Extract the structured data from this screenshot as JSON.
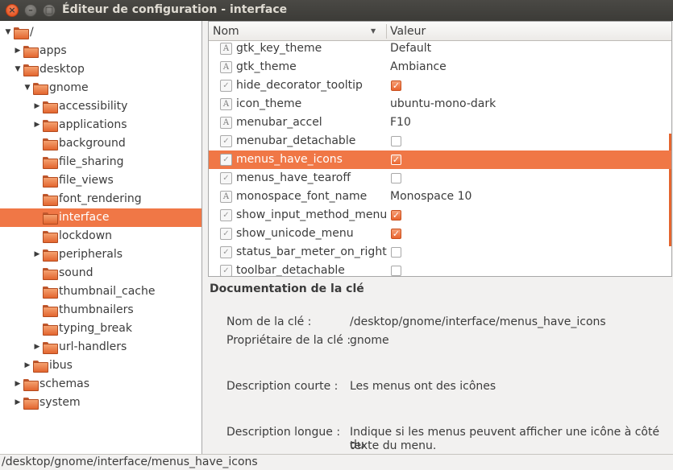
{
  "window": {
    "title": "Éditeur de configuration - interface",
    "close_glyph": "×",
    "min_glyph": "–",
    "max_glyph": "□"
  },
  "tree": {
    "items": [
      {
        "label": "/",
        "level": 0,
        "expanded": true,
        "has_children": true,
        "selected": false
      },
      {
        "label": "apps",
        "level": 1,
        "expanded": false,
        "has_children": true,
        "selected": false
      },
      {
        "label": "desktop",
        "level": 1,
        "expanded": true,
        "has_children": true,
        "selected": false
      },
      {
        "label": "gnome",
        "level": 2,
        "expanded": true,
        "has_children": true,
        "selected": false
      },
      {
        "label": "accessibility",
        "level": 3,
        "expanded": false,
        "has_children": true,
        "selected": false
      },
      {
        "label": "applications",
        "level": 3,
        "expanded": false,
        "has_children": true,
        "selected": false
      },
      {
        "label": "background",
        "level": 3,
        "expanded": false,
        "has_children": false,
        "selected": false
      },
      {
        "label": "file_sharing",
        "level": 3,
        "expanded": false,
        "has_children": false,
        "selected": false
      },
      {
        "label": "file_views",
        "level": 3,
        "expanded": false,
        "has_children": false,
        "selected": false
      },
      {
        "label": "font_rendering",
        "level": 3,
        "expanded": false,
        "has_children": false,
        "selected": false
      },
      {
        "label": "interface",
        "level": 3,
        "expanded": false,
        "has_children": false,
        "selected": true
      },
      {
        "label": "lockdown",
        "level": 3,
        "expanded": false,
        "has_children": false,
        "selected": false
      },
      {
        "label": "peripherals",
        "level": 3,
        "expanded": false,
        "has_children": true,
        "selected": false
      },
      {
        "label": "sound",
        "level": 3,
        "expanded": false,
        "has_children": false,
        "selected": false
      },
      {
        "label": "thumbnail_cache",
        "level": 3,
        "expanded": false,
        "has_children": false,
        "selected": false
      },
      {
        "label": "thumbnailers",
        "level": 3,
        "expanded": false,
        "has_children": false,
        "selected": false
      },
      {
        "label": "typing_break",
        "level": 3,
        "expanded": false,
        "has_children": false,
        "selected": false
      },
      {
        "label": "url-handlers",
        "level": 3,
        "expanded": false,
        "has_children": true,
        "selected": false
      },
      {
        "label": "ibus",
        "level": 2,
        "expanded": false,
        "has_children": true,
        "selected": false
      },
      {
        "label": "schemas",
        "level": 1,
        "expanded": false,
        "has_children": true,
        "selected": false
      },
      {
        "label": "system",
        "level": 1,
        "expanded": false,
        "has_children": true,
        "selected": false
      }
    ]
  },
  "keys": {
    "col_name": "Nom",
    "col_value": "Valeur",
    "rows": [
      {
        "name": "gtk_key_theme",
        "type": "string",
        "value": "Default",
        "selected": false
      },
      {
        "name": "gtk_theme",
        "type": "string",
        "value": "Ambiance",
        "selected": false
      },
      {
        "name": "hide_decorator_tooltip",
        "type": "bool",
        "checked": true,
        "selected": false
      },
      {
        "name": "icon_theme",
        "type": "string",
        "value": "ubuntu-mono-dark",
        "selected": false
      },
      {
        "name": "menubar_accel",
        "type": "string",
        "value": "F10",
        "selected": false
      },
      {
        "name": "menubar_detachable",
        "type": "bool",
        "checked": false,
        "selected": false
      },
      {
        "name": "menus_have_icons",
        "type": "bool",
        "checked": true,
        "selected": true
      },
      {
        "name": "menus_have_tearoff",
        "type": "bool",
        "checked": false,
        "selected": false
      },
      {
        "name": "monospace_font_name",
        "type": "string",
        "value": "Monospace 10",
        "selected": false
      },
      {
        "name": "show_input_method_menu",
        "type": "bool",
        "checked": true,
        "selected": false
      },
      {
        "name": "show_unicode_menu",
        "type": "bool",
        "checked": true,
        "selected": false
      },
      {
        "name": "status_bar_meter_on_right",
        "type": "bool",
        "checked": false,
        "selected": false
      },
      {
        "name": "toolbar_detachable",
        "type": "bool",
        "checked": false,
        "selected": false
      }
    ]
  },
  "doc": {
    "title": "Documentation de la clé",
    "key_name_label": "Nom de la clé :",
    "key_name_value": "/desktop/gnome/interface/menus_have_icons",
    "owner_label": "Propriétaire de la clé :",
    "owner_value": "gnome",
    "short_desc_label": "Description courte :",
    "short_desc_value": "Les menus ont des icônes",
    "long_desc_label": "Description longue :",
    "long_desc_line1": "Indique si les menus peuvent afficher une icône à côté du",
    "long_desc_line2": "texte du menu."
  },
  "status": {
    "path": "/desktop/gnome/interface/menus_have_icons"
  },
  "colors": {
    "selection": "#f07746",
    "titlebar": "#3c3b37"
  }
}
